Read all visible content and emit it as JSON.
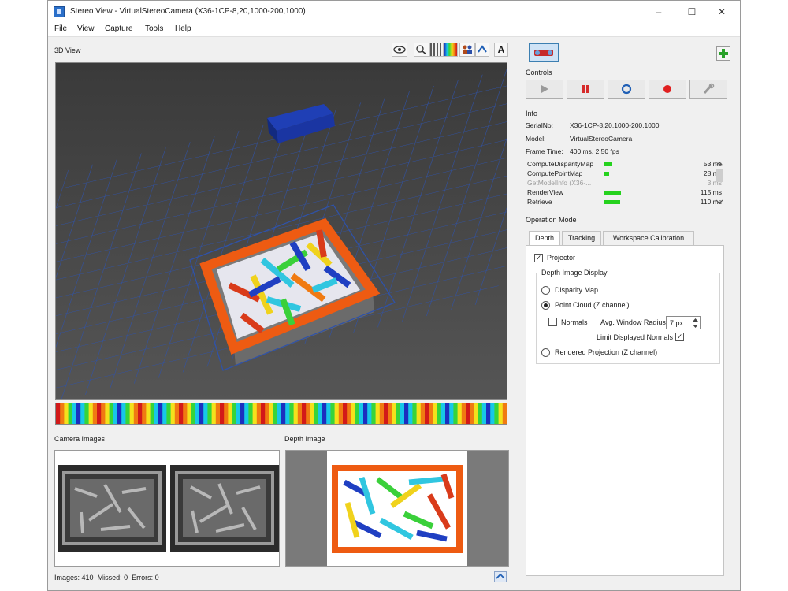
{
  "window": {
    "title": "Stereo View - VirtualStereoCamera (X36-1CP-8,20,1000-200,1000)",
    "controls": [
      "–",
      "☐",
      "✕"
    ]
  },
  "menu": [
    "File",
    "View",
    "Capture",
    "Tools",
    "Help"
  ],
  "view3d": {
    "label": "3D View",
    "toolbar": {
      "text_button": "A"
    }
  },
  "camera_images": {
    "label": "Camera Images"
  },
  "depth_image": {
    "label": "Depth Image"
  },
  "status": {
    "images_label": "Images:",
    "images": "410",
    "missed_label": "Missed:",
    "missed": "0",
    "errors_label": "Errors:",
    "errors": "0"
  },
  "controls": {
    "label": "Controls"
  },
  "info": {
    "label": "Info",
    "serial_label": "SerialNo:",
    "serial": "X36-1CP-8,20,1000-200,1000",
    "model_label": "Model:",
    "model": "VirtualStereoCamera",
    "frame_label": "Frame Time:",
    "frame": "400 ms, 2.50 fps",
    "timings": [
      {
        "name": "ComputeDisparityMap",
        "value": "53 ms",
        "bar_fraction": 0.35,
        "dim": false
      },
      {
        "name": "ComputePointMap",
        "value": "28 ms",
        "bar_fraction": 0.2,
        "dim": false
      },
      {
        "name": "GetModelInfo (X36-...",
        "value": "3 ms",
        "bar_fraction": 0,
        "dim": true
      },
      {
        "name": "RenderView",
        "value": "115 ms",
        "bar_fraction": 0.75,
        "dim": false
      },
      {
        "name": "Retrieve",
        "value": "110 ms",
        "bar_fraction": 0.72,
        "dim": false
      }
    ]
  },
  "operation_mode": {
    "label": "Operation Mode",
    "tabs": [
      "Depth",
      "Tracking",
      "Workspace Calibration"
    ],
    "active_tab": "Depth",
    "projector": {
      "label": "Projector",
      "checked": true
    },
    "group_title": "Depth Image Display",
    "disparity_map": {
      "label": "Disparity Map",
      "selected": false
    },
    "point_cloud": {
      "label": "Point Cloud (Z channel)",
      "selected": true
    },
    "normals": {
      "label": "Normals",
      "checked": false
    },
    "avg_window_label": "Avg. Window Radius:",
    "avg_window_value": "7 px",
    "limit_normals": {
      "label": "Limit Displayed Normals",
      "checked": true
    },
    "rendered_projection": {
      "label": "Rendered Projection (Z channel)",
      "selected": false
    }
  },
  "colors": {
    "accent_green": "#26d21e",
    "pause_red": "#d62a2a",
    "record_red": "#e02020",
    "stop_blue": "#1f5fb5"
  }
}
